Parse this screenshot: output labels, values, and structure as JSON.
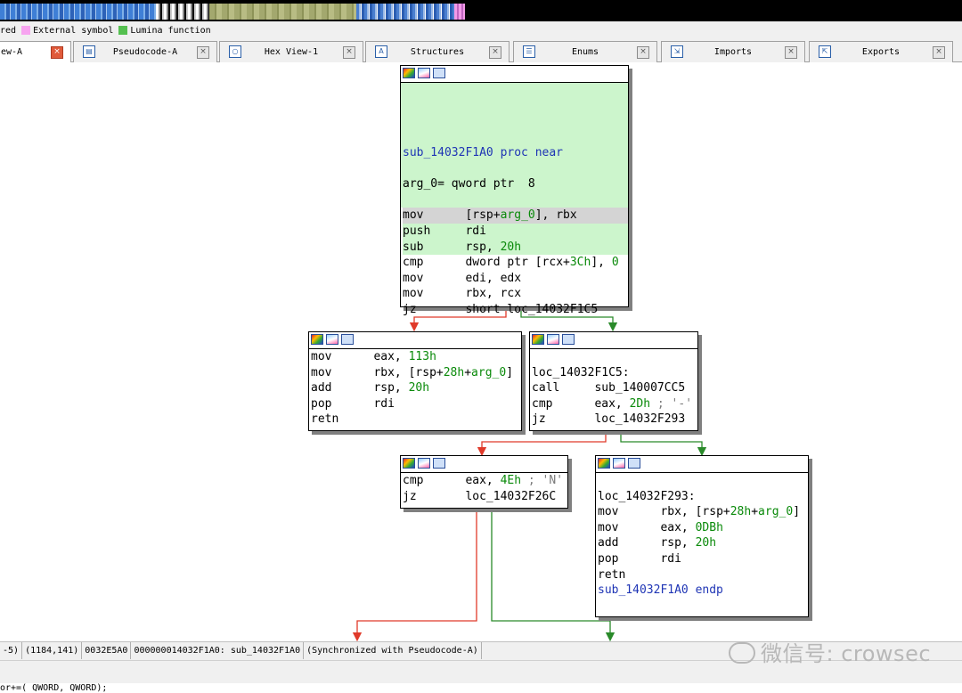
{
  "legend": {
    "items": [
      {
        "label": "red",
        "color": "#f0f0f0"
      },
      {
        "label": "External symbol",
        "color": "#f7a4f0"
      },
      {
        "label": "Lumina function",
        "color": "#55c050"
      }
    ]
  },
  "tabs": [
    {
      "label": "ew-A",
      "icon": "graph-icon",
      "active": true
    },
    {
      "label": "Pseudocode-A",
      "icon": "pseudocode-icon",
      "active": false
    },
    {
      "label": "Hex View-1",
      "icon": "hex-view-icon",
      "active": false
    },
    {
      "label": "Structures",
      "icon": "structures-icon",
      "active": false
    },
    {
      "label": "Enums",
      "icon": "enums-icon",
      "active": false
    },
    {
      "label": "Imports",
      "icon": "imports-icon",
      "active": false
    },
    {
      "label": "Exports",
      "icon": "exports-icon",
      "active": false
    }
  ],
  "nodes": {
    "entry": {
      "proc": "sub_14032F1A0 proc near",
      "arg": "arg_0= qword ptr  8",
      "lines": [
        {
          "m": "mov",
          "o": "[rsp+arg_0], rbx"
        },
        {
          "m": "push",
          "o": "rdi"
        },
        {
          "m": "sub",
          "o": "rsp, 20h"
        },
        {
          "m": "cmp",
          "o": "dword ptr [rcx+3Ch], 0"
        },
        {
          "m": "mov",
          "o": "edi, edx"
        },
        {
          "m": "mov",
          "o": "rbx, rcx"
        },
        {
          "m": "jz",
          "o": "short loc_14032F1C5"
        }
      ]
    },
    "left1": {
      "lines": [
        {
          "m": "mov",
          "o": "eax, 113h"
        },
        {
          "m": "mov",
          "o": "rbx, [rsp+28h+arg_0]"
        },
        {
          "m": "add",
          "o": "rsp, 20h"
        },
        {
          "m": "pop",
          "o": "rdi"
        },
        {
          "m": "retn",
          "o": ""
        }
      ]
    },
    "right1": {
      "label": "loc_14032F1C5:",
      "lines": [
        {
          "m": "call",
          "o": "sub_140007CC5"
        },
        {
          "m": "cmp",
          "o": "eax, 2Dh ; '-'"
        },
        {
          "m": "jz",
          "o": "loc_14032F293"
        }
      ]
    },
    "left2": {
      "lines": [
        {
          "m": "cmp",
          "o": "eax, 4Eh ; 'N'"
        },
        {
          "m": "jz",
          "o": "loc_14032F26C"
        }
      ]
    },
    "right2": {
      "label": "loc_14032F293:",
      "lines": [
        {
          "m": "mov",
          "o": "rbx, [rsp+28h+arg_0]"
        },
        {
          "m": "mov",
          "o": "eax, 0DBh"
        },
        {
          "m": "add",
          "o": "rsp, 20h"
        },
        {
          "m": "pop",
          "o": "rdi"
        },
        {
          "m": "retn",
          "o": ""
        }
      ],
      "endp": "sub_14032F1A0 endp"
    }
  },
  "status": {
    "zoom": "-5)",
    "coords": "(1184,141)",
    "offset": "0032E5A0",
    "address": "000000014032F1A0: sub_14032F1A0",
    "sync": "(Synchronized with Pseudocode-A)"
  },
  "output_line": "or+=( QWORD,  QWORD);",
  "watermark": "微信号: crowsec"
}
